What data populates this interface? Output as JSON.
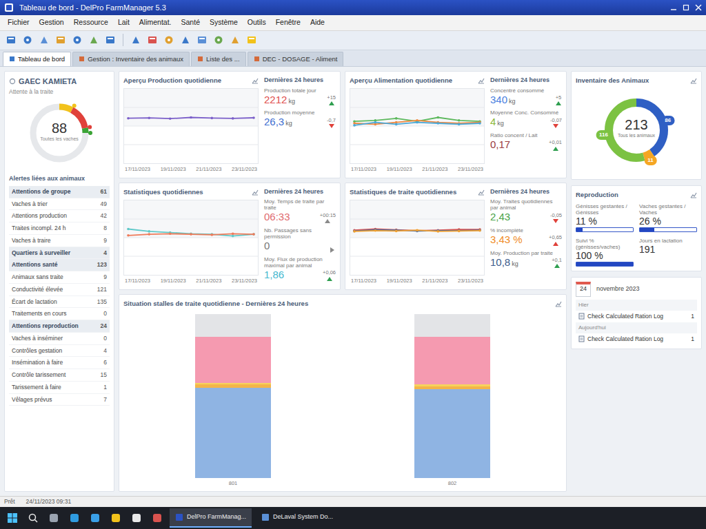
{
  "window": {
    "title": "Tableau de bord - DelPro FarmManager 5.3"
  },
  "menu": [
    "Fichier",
    "Gestion",
    "Ressource",
    "Lait",
    "Alimentat.",
    "Santé",
    "Système",
    "Outils",
    "Fenêtre",
    "Aide"
  ],
  "tabs": [
    {
      "label": "Tableau de bord",
      "selected": true
    },
    {
      "label": "Gestion : Inventaire des animaux",
      "selected": false
    },
    {
      "label": "Liste des ...",
      "selected": false
    },
    {
      "label": "DEC - DOSAGE - Aliment",
      "selected": false
    }
  ],
  "farm": {
    "name": "GAEC KAMIETA",
    "subtitle": "Attente à la traite",
    "gauge": {
      "value": "88",
      "label": "Toutes les vaches",
      "segments": [
        {
          "color": "#f2c21b",
          "level": 0.08
        },
        {
          "color": "#e0413a",
          "level": 0.14
        },
        {
          "color": "#3aa335",
          "level": 0.03
        }
      ]
    }
  },
  "alerts": {
    "title": "Alertes liées aux animaux",
    "items": [
      {
        "label": "Attentions de groupe",
        "count": "61",
        "kind": "group"
      },
      {
        "label": "Vaches à trier",
        "count": "49",
        "kind": "item"
      },
      {
        "label": "Attentions production",
        "count": "42",
        "kind": "item"
      },
      {
        "label": "Traites incompl. 24 h",
        "count": "8",
        "kind": "item"
      },
      {
        "label": "Vaches à traire",
        "count": "9",
        "kind": "item"
      },
      {
        "label": "Quartiers à surveiller",
        "count": "4",
        "kind": "group"
      },
      {
        "label": "Attentions santé",
        "count": "123",
        "kind": "group"
      },
      {
        "label": "Animaux sans traite",
        "count": "9",
        "kind": "item"
      },
      {
        "label": "Conductivité élevée",
        "count": "121",
        "kind": "item"
      },
      {
        "label": "Écart de lactation",
        "count": "135",
        "kind": "item"
      },
      {
        "label": "Traitements en cours",
        "count": "0",
        "kind": "item"
      },
      {
        "label": "Attentions reproduction",
        "count": "24",
        "kind": "group"
      },
      {
        "label": "Vaches à inséminer",
        "count": "0",
        "kind": "item"
      },
      {
        "label": "Contrôles gestation",
        "count": "4",
        "kind": "item"
      },
      {
        "label": "Insémination à faire",
        "count": "6",
        "kind": "item"
      },
      {
        "label": "Contrôle tarissement",
        "count": "15",
        "kind": "item"
      },
      {
        "label": "Tarissement à faire",
        "count": "1",
        "kind": "item"
      },
      {
        "label": "Vêlages prévus",
        "count": "7",
        "kind": "item"
      }
    ]
  },
  "production": {
    "title": "Aperçu Production quotidienne",
    "chart": {
      "x_labels": [
        "17/11/2023",
        "19/11/2023",
        "21/11/2023",
        "23/11/2023"
      ],
      "series": [
        {
          "color": "#7b5fc9",
          "values": [
            26.0,
            26.2,
            25.8,
            26.5,
            26.1,
            25.9,
            26.3
          ]
        }
      ]
    },
    "stats_title": "Dernières 24 heures",
    "stats": [
      {
        "label": "Production totale jour",
        "value": "2212",
        "unit": "kg",
        "color": "#e0504f",
        "delta": "+15",
        "trend": "up",
        "trend_color": "#2e9e4f"
      },
      {
        "label": "Production moyenne",
        "value": "26,3",
        "unit": "kg",
        "color": "#3f6fd1",
        "delta": "-0,7",
        "trend": "down",
        "trend_color": "#e0413a"
      }
    ]
  },
  "feeding": {
    "title": "Aperçu Alimentation quotidienne",
    "chart": {
      "x_labels": [
        "17/11/2023",
        "19/11/2023",
        "21/11/2023",
        "23/11/2023"
      ],
      "series": [
        {
          "color": "#5cb85c",
          "values": [
            4.0,
            4.1,
            4.3,
            4.0,
            4.4,
            4.1,
            4.0
          ]
        },
        {
          "color": "#f0883e",
          "values": [
            3.8,
            3.7,
            3.9,
            4.1,
            3.9,
            3.8,
            3.9
          ]
        },
        {
          "color": "#4aa8d8",
          "values": [
            3.6,
            3.9,
            3.7,
            3.9,
            3.8,
            3.7,
            3.8
          ]
        }
      ]
    },
    "stats_title": "Dernières 24 heures",
    "stats": [
      {
        "label": "Concentré consommé",
        "value": "340",
        "unit": "kg",
        "color": "#4a7fe0",
        "delta": "+5",
        "trend": "up",
        "trend_color": "#2e9e4f"
      },
      {
        "label": "Moyenne Conc. Consommé",
        "value": "4",
        "unit": "kg",
        "color": "#8cb83a",
        "delta": "-0,07",
        "trend": "down",
        "trend_color": "#e0413a"
      },
      {
        "label": "Ratio concent / Lait",
        "value": "0,17",
        "color": "#9a3a3e",
        "delta": "+0,01",
        "trend": "up",
        "trend_color": "#2e9e4f"
      }
    ]
  },
  "daily": {
    "title": "Statistiques quotidiennes",
    "chart": {
      "x_labels": [
        "17/11/2023",
        "19/11/2023",
        "21/11/2023",
        "23/11/2023"
      ],
      "series": [
        {
          "color": "#5fc9c9",
          "values": [
            7.4,
            7.0,
            6.8,
            6.6,
            6.5,
            6.2,
            6.5
          ]
        },
        {
          "color": "#ef7b5a",
          "values": [
            6.3,
            6.5,
            6.6,
            6.5,
            6.4,
            6.6,
            6.5
          ]
        }
      ]
    },
    "stats_title": "Dernières 24 heures",
    "stats": [
      {
        "label": "Moy. Temps de traite par traite",
        "value": "06:33",
        "color": "#e06b70",
        "delta": "+00:15",
        "trend": "up",
        "trend_color": "#8a8a8a"
      },
      {
        "label": "Nb. Passages sans permission",
        "value": "0",
        "color": "#777777",
        "trend": "flat",
        "trend_color": "#8a8a8a"
      },
      {
        "label": "Moy. Flux de production maximal par animal",
        "value": "1,86",
        "color": "#45b8cf",
        "delta": "+0,06",
        "trend": "up",
        "trend_color": "#2e9e4f"
      }
    ]
  },
  "milking": {
    "title": "Statistiques de traite quotidiennes",
    "chart": {
      "x_labels": [
        "17/11/2023",
        "19/11/2023",
        "21/11/2023",
        "23/11/2023"
      ],
      "series": [
        {
          "color": "#d9534f",
          "values": [
            10.6,
            10.9,
            10.7,
            10.5,
            10.6,
            10.8,
            10.8
          ]
        },
        {
          "color": "#4a6fa5",
          "values": [
            10.4,
            10.7,
            10.6,
            10.4,
            10.5,
            10.5,
            10.6
          ]
        },
        {
          "color": "#f0a030",
          "values": [
            10.3,
            10.5,
            10.4,
            10.6,
            10.3,
            10.4,
            10.5
          ]
        }
      ]
    },
    "stats_title": "Dernières 24 heures",
    "stats": [
      {
        "label": "Moy. Traites quotidiennes par animal",
        "value": "2,43",
        "color": "#4aa34a",
        "delta": "-0,05",
        "trend": "down",
        "trend_color": "#e0413a"
      },
      {
        "label": "% incomplète",
        "value": "3,43 %",
        "color": "#f08c28",
        "delta": "+0,65",
        "trend": "up",
        "trend_color": "#e0413a"
      },
      {
        "label": "Moy. Production par traite",
        "value": "10,8",
        "unit": "kg",
        "color": "#3b5b8c",
        "delta": "+0,1",
        "trend": "up",
        "trend_color": "#2e9e4f"
      }
    ]
  },
  "stalls": {
    "title": "Situation stalles de traite quotidienne - Dernières 24 heures",
    "categories": [
      "801",
      "802"
    ],
    "series": [
      {
        "color": "#8fb4e3",
        "values": [
          55,
          54
        ]
      },
      {
        "color": "#f3b54a",
        "values": [
          2,
          2
        ]
      },
      {
        "color": "#f7d35c",
        "values": [
          1,
          1
        ]
      },
      {
        "color": "#f59ab0",
        "values": [
          28,
          29
        ]
      }
    ]
  },
  "inventory": {
    "title": "Inventaire des Animaux",
    "total": "213",
    "label": "Tous les animaux",
    "segments": [
      {
        "label": "86",
        "color": "#2f5fc4"
      },
      {
        "label": "11",
        "color": "#f5a623"
      },
      {
        "label": "116",
        "color": "#7cc242"
      }
    ]
  },
  "reproduction": {
    "title": "Reproduction",
    "metrics": [
      {
        "label": "Génisses gestantes / Génisses",
        "value": "11 %",
        "kind": "bar",
        "level": 0.11
      },
      {
        "label": "Vaches gestantes / Vaches",
        "value": "26 %",
        "kind": "bar",
        "level": 0.26
      },
      {
        "label": "Suivi % (génisses/vaches)",
        "value": "100 %",
        "kind": "bar",
        "level": 1.0
      },
      {
        "label": "Jours en lactation",
        "value": "191",
        "kind": "number"
      }
    ]
  },
  "calendar": {
    "day": "24",
    "month": "novembre 2023",
    "groups": [
      {
        "label": "Hier",
        "items": [
          {
            "text": "Check Calculated Ration Log",
            "count": "1"
          }
        ]
      },
      {
        "label": "Aujourd'hui",
        "items": [
          {
            "text": "Check Calculated Ration Log",
            "count": "1"
          }
        ]
      }
    ]
  },
  "status_bar": [
    "Prêt",
    "24/11/2023 09:31"
  ],
  "taskbar": {
    "items": [
      {
        "label": "DelPro FarmManag...",
        "selected": true
      },
      {
        "label": "DeLaval System Do...",
        "selected": false
      }
    ]
  }
}
